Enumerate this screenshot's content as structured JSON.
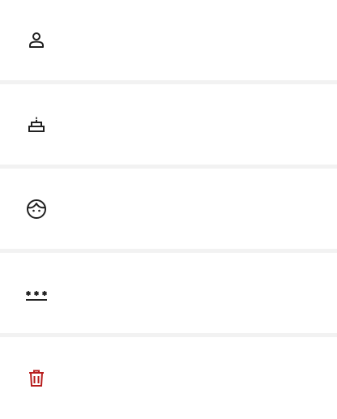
{
  "settings_list": {
    "items": [
      {
        "id": "profile",
        "icon": "person-icon",
        "label": ""
      },
      {
        "id": "birthday",
        "icon": "cake-icon",
        "label": ""
      },
      {
        "id": "face",
        "icon": "face-icon",
        "label": ""
      },
      {
        "id": "password",
        "icon": "password-icon",
        "label": ""
      },
      {
        "id": "delete",
        "icon": "trash-icon",
        "label": ""
      }
    ]
  },
  "colors": {
    "background": "#f2f2f2",
    "row": "#ffffff",
    "icon": "#212121",
    "danger": "#b71c1c"
  }
}
